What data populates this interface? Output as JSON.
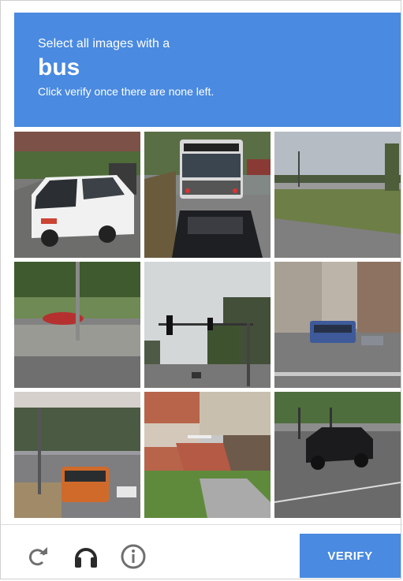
{
  "header": {
    "line1": "Select all images with a",
    "target": "bus",
    "line2": "Click verify once there are none left."
  },
  "tiles": [
    {
      "content": "white minivan parked on street"
    },
    {
      "content": "bus front view on road"
    },
    {
      "content": "empty road with grass"
    },
    {
      "content": "red car behind concrete barrier"
    },
    {
      "content": "traffic light and trees"
    },
    {
      "content": "city street with bus"
    },
    {
      "content": "orange bus at intersection"
    },
    {
      "content": "brick house with stairs"
    },
    {
      "content": "black SUV on highway"
    }
  ],
  "footer": {
    "reload_icon": "reload-icon",
    "audio_icon": "headphones-icon",
    "info_icon": "info-icon",
    "verify_label": "VERIFY"
  },
  "colors": {
    "accent": "#4a8ae0"
  }
}
